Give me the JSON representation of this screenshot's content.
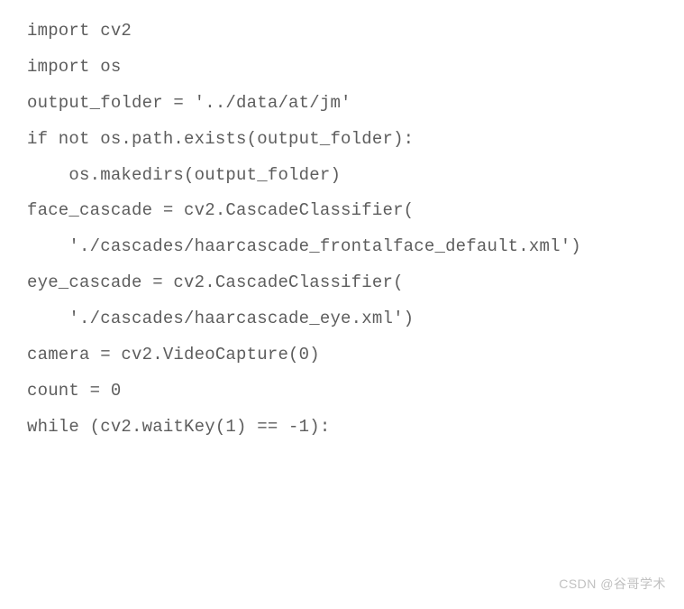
{
  "code": {
    "lines": [
      "import cv2",
      "import os",
      "",
      "",
      "output_folder = '../data/at/jm'",
      "if not os.path.exists(output_folder):",
      "    os.makedirs(output_folder)",
      "",
      "face_cascade = cv2.CascadeClassifier(",
      "    './cascades/haarcascade_frontalface_default.xml')",
      "eye_cascade = cv2.CascadeClassifier(",
      "    './cascades/haarcascade_eye.xml')",
      "",
      "camera = cv2.VideoCapture(0)",
      "count = 0",
      "while (cv2.waitKey(1) == -1):"
    ]
  },
  "watermark": "CSDN @谷哥学术"
}
